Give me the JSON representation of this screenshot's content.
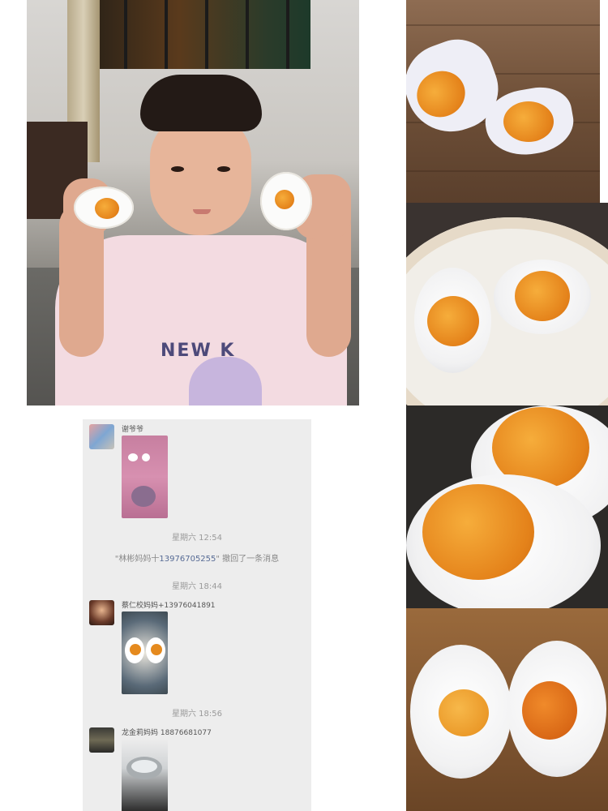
{
  "chat": {
    "messages": [
      {
        "sender": "谢爷爷"
      },
      {
        "sender": "蔡仁校妈妈+13976041891"
      },
      {
        "sender": "龙金莉妈妈 18876681077"
      }
    ],
    "timestamps": [
      "星期六 12:54",
      "星期六 18:44",
      "星期六 18:56"
    ],
    "recall": {
      "prefix": "\"林彬妈妈十",
      "phone": "13976705255",
      "suffix": "\" 撤回了一条消息"
    }
  },
  "photos": {
    "child": {
      "shirt_text": "NEW  K"
    }
  },
  "colors": {
    "chat_bg": "#ededed",
    "link": "#576b95",
    "yolk": "#e4821a"
  }
}
